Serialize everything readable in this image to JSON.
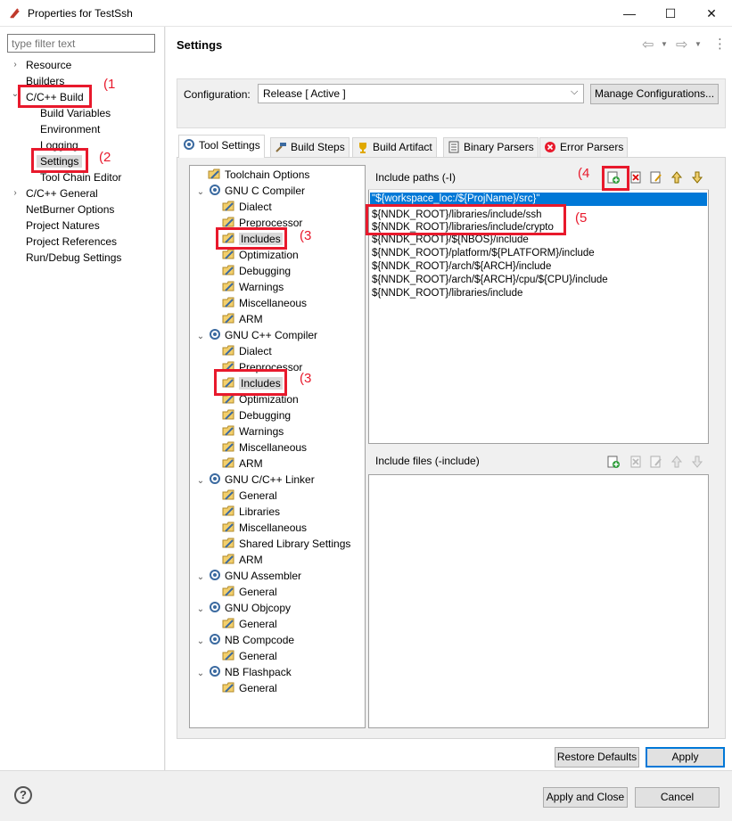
{
  "window": {
    "title": "Properties for TestSsh",
    "controls": [
      "—",
      "☐",
      "✕"
    ]
  },
  "left_nav": {
    "filter_placeholder": "type filter text",
    "items": [
      {
        "label": "Resource",
        "expander": "›"
      },
      {
        "label": "Builders"
      },
      {
        "label": "C/C++ Build",
        "expander": "⌄"
      },
      {
        "label": "Build Variables"
      },
      {
        "label": "Environment"
      },
      {
        "label": "Logging"
      },
      {
        "label": "Settings"
      },
      {
        "label": "Tool Chain Editor"
      },
      {
        "label": "C/C++ General",
        "expander": "›"
      },
      {
        "label": "NetBurner Options"
      },
      {
        "label": "Project Natures"
      },
      {
        "label": "Project References"
      },
      {
        "label": "Run/Debug Settings"
      }
    ]
  },
  "header": {
    "title": "Settings",
    "nav_back": "⇦",
    "nav_fwd": "⇨",
    "menu": "⋮"
  },
  "configuration": {
    "label": "Configuration:",
    "value": "Release  [ Active ]",
    "manage_button": "Manage Configurations..."
  },
  "tabs": [
    {
      "label": "Tool Settings",
      "active": true
    },
    {
      "label": "Build Steps"
    },
    {
      "label": "Build Artifact"
    },
    {
      "label": "Binary Parsers"
    },
    {
      "label": "Error Parsers"
    }
  ],
  "tool_tree": [
    {
      "label": "Toolchain Options",
      "level": 1
    },
    {
      "label": "GNU C Compiler",
      "level": 0
    },
    {
      "label": "Dialect",
      "level": 1
    },
    {
      "label": "Preprocessor",
      "level": 1
    },
    {
      "label": "Includes",
      "level": 1
    },
    {
      "label": "Optimization",
      "level": 1
    },
    {
      "label": "Debugging",
      "level": 1
    },
    {
      "label": "Warnings",
      "level": 1
    },
    {
      "label": "Miscellaneous",
      "level": 1
    },
    {
      "label": "ARM",
      "level": 1
    },
    {
      "label": "GNU C++ Compiler",
      "level": 0
    },
    {
      "label": "Dialect",
      "level": 1
    },
    {
      "label": "Preprocessor",
      "level": 1
    },
    {
      "label": "Includes",
      "level": 1
    },
    {
      "label": "Optimization",
      "level": 1
    },
    {
      "label": "Debugging",
      "level": 1
    },
    {
      "label": "Warnings",
      "level": 1
    },
    {
      "label": "Miscellaneous",
      "level": 1
    },
    {
      "label": "ARM",
      "level": 1
    },
    {
      "label": "GNU C/C++ Linker",
      "level": 0
    },
    {
      "label": "General",
      "level": 1
    },
    {
      "label": "Libraries",
      "level": 1
    },
    {
      "label": "Miscellaneous",
      "level": 1
    },
    {
      "label": "Shared Library Settings",
      "level": 1
    },
    {
      "label": "ARM",
      "level": 1
    },
    {
      "label": "GNU Assembler",
      "level": 0
    },
    {
      "label": "General",
      "level": 1
    },
    {
      "label": "GNU Objcopy",
      "level": 0
    },
    {
      "label": "General",
      "level": 1
    },
    {
      "label": "NB Compcode",
      "level": 0
    },
    {
      "label": "General",
      "level": 1
    },
    {
      "label": "NB Flashpack",
      "level": 0
    },
    {
      "label": "General",
      "level": 1
    }
  ],
  "include_paths": {
    "title": "Include paths (-I)",
    "paths": [
      "\"${workspace_loc:/${ProjName}/src}\"",
      "${NNDK_ROOT}/libraries/include/ssh",
      "${NNDK_ROOT}/libraries/include/crypto",
      "${NNDK_ROOT}/${NBOS}/include",
      "${NNDK_ROOT}/platform/${PLATFORM}/include",
      "${NNDK_ROOT}/arch/${ARCH}/include",
      "${NNDK_ROOT}/arch/${ARCH}/cpu/${CPU}/include",
      "${NNDK_ROOT}/libraries/include"
    ]
  },
  "include_files": {
    "title": "Include files (-include)"
  },
  "annotations": [
    "(1",
    "(2",
    "(3",
    "(3",
    "(4",
    "(5"
  ],
  "buttons": {
    "restore_defaults": "Restore Defaults",
    "apply": "Apply",
    "apply_close": "Apply and Close",
    "cancel": "Cancel",
    "help": "?"
  },
  "colors": {
    "annotation_red": "#e8192c",
    "selection_blue": "#0078d7"
  }
}
